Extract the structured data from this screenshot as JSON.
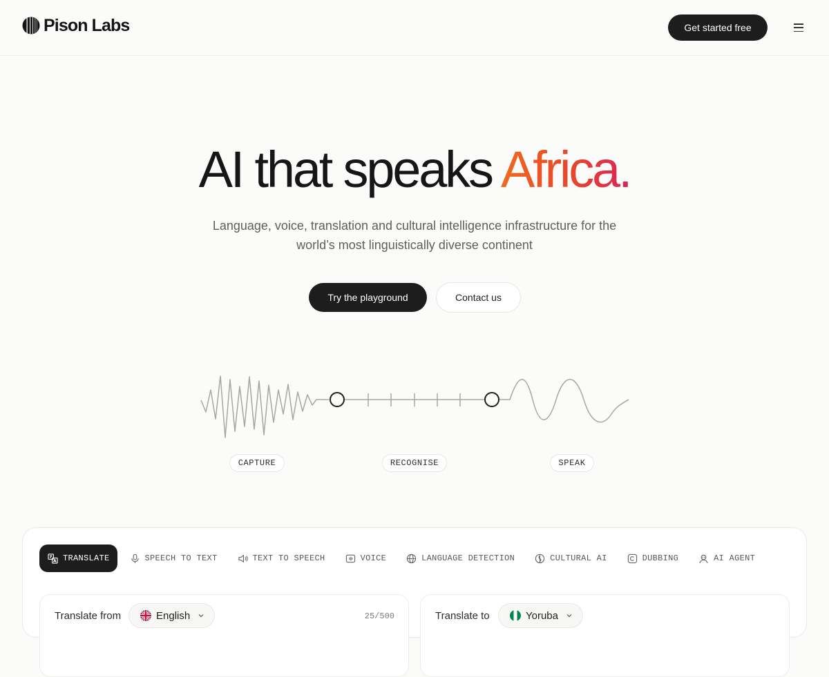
{
  "header": {
    "logo_text": "Pison Labs",
    "cta_label": "Get started free",
    "menu_icon": "hamburger-menu-icon"
  },
  "hero": {
    "title_main": "AI that speaks ",
    "title_accent": "Africa.",
    "subtitle": "Language, voice, translation and cultural intelligence infrastructure for the world’s most linguistically diverse continent",
    "primary_button": "Try the playground",
    "secondary_button": "Contact us"
  },
  "pipeline": {
    "stages": [
      "CAPTURE",
      "RECOGNISE",
      "SPEAK"
    ]
  },
  "playground": {
    "tabs": [
      {
        "label": "TRANSLATE",
        "icon": "translate-icon",
        "active": true
      },
      {
        "label": "SPEECH TO TEXT",
        "icon": "microphone-icon",
        "active": false
      },
      {
        "label": "TEXT TO SPEECH",
        "icon": "speaker-icon",
        "active": false
      },
      {
        "label": "VOICE",
        "icon": "voice-icon",
        "active": false
      },
      {
        "label": "LANGUAGE DETECTION",
        "icon": "globe-icon",
        "active": false
      },
      {
        "label": "CULTURAL AI",
        "icon": "cultural-icon",
        "active": false
      },
      {
        "label": "DUBBING",
        "icon": "dubbing-icon",
        "active": false
      },
      {
        "label": "AI AGENT",
        "icon": "agent-icon",
        "active": false
      }
    ],
    "source": {
      "label": "Translate from",
      "language": "English",
      "flag_icon": "uk-flag-icon",
      "char_count": "25/500"
    },
    "target": {
      "label": "Translate to",
      "language": "Yoruba",
      "flag_icon": "nigeria-flag-icon"
    }
  },
  "colors": {
    "accent_start": "#ef6a1f",
    "accent_end": "#d8245a",
    "dark": "#1d1d1d"
  }
}
